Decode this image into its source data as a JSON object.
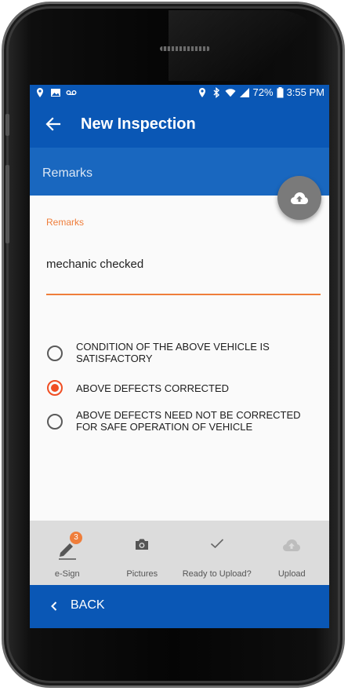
{
  "status_bar": {
    "time": "3:55 PM",
    "battery_percent": "72%",
    "icons_left": [
      "location-pin-icon",
      "image-icon",
      "voicemail-icon"
    ],
    "icons_right": [
      "location-icon",
      "bluetooth-icon",
      "wifi-icon",
      "signal-icon",
      "battery-icon"
    ]
  },
  "app_bar": {
    "title": "New Inspection"
  },
  "section": {
    "title": "Remarks"
  },
  "remarks_field": {
    "label": "Remarks",
    "value": "mechanic checked"
  },
  "condition_options": [
    {
      "label": "CONDITION OF THE ABOVE VEHICLE IS SATISFACTORY",
      "selected": false
    },
    {
      "label": "ABOVE DEFECTS CORRECTED",
      "selected": true
    },
    {
      "label": "ABOVE DEFECTS NEED NOT BE CORRECTED FOR SAFE OPERATION OF VEHICLE",
      "selected": false
    }
  ],
  "bottom_tabs": [
    {
      "label": "e-Sign",
      "icon": "pen-icon",
      "badge": "3"
    },
    {
      "label": "Pictures",
      "icon": "camera-icon"
    },
    {
      "label": "Ready to Upload?",
      "icon": "check-icon"
    },
    {
      "label": "Upload",
      "icon": "cloud-upload-icon"
    }
  ],
  "footer": {
    "back_label": "BACK"
  },
  "colors": {
    "primary": "#0a57b5",
    "section": "#1967bf",
    "accent": "#ef7e3b",
    "radio_selected": "#f04e23",
    "fab": "#7a7a7a",
    "tab_bar": "#dcdcdc"
  }
}
